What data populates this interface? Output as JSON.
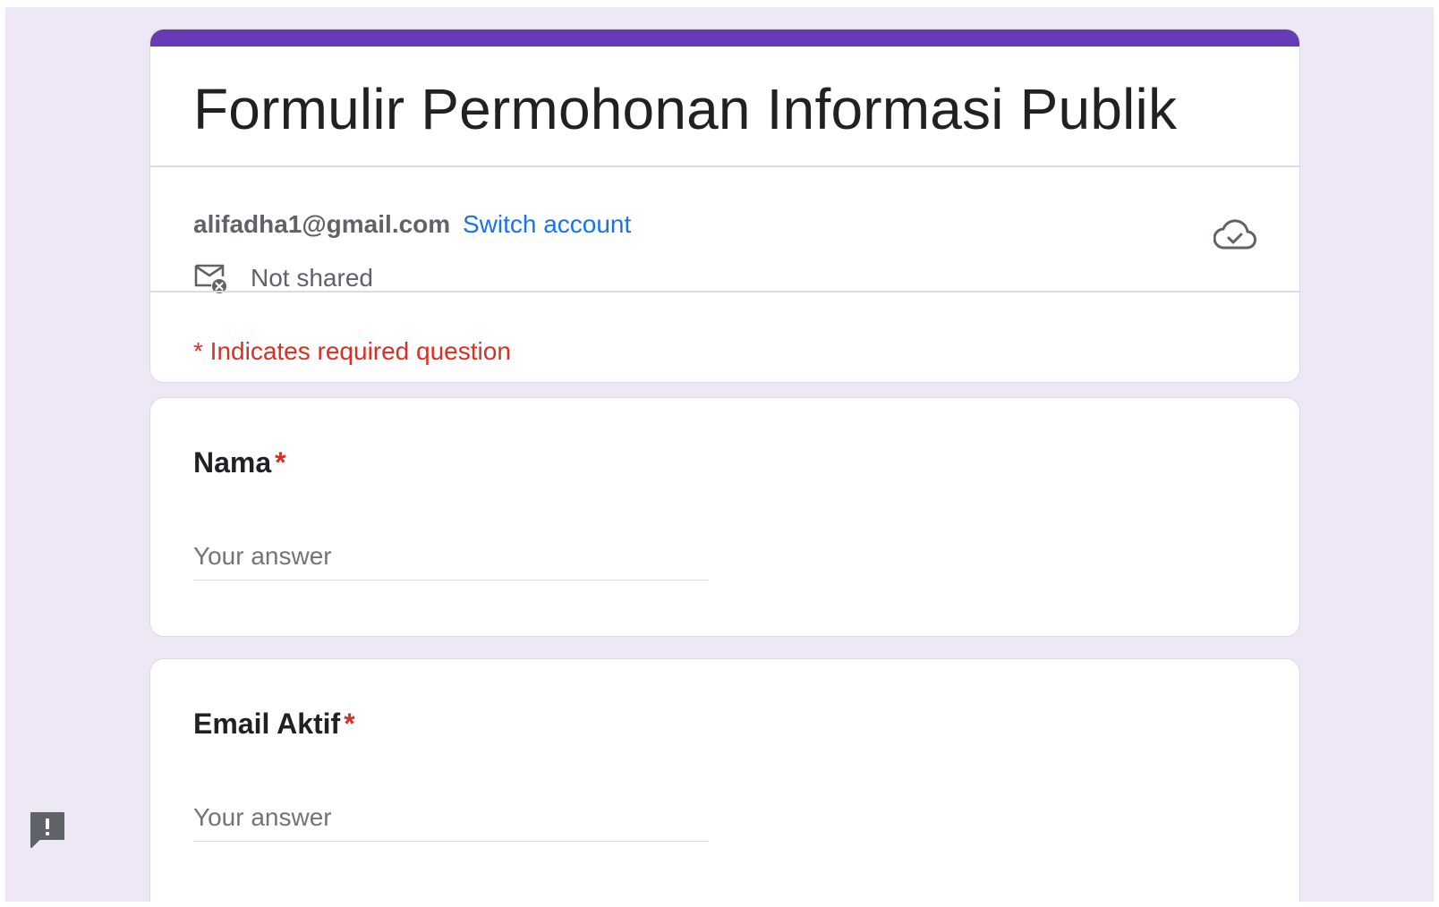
{
  "form": {
    "title": "Formulir Permohonan Informasi Publik",
    "account_email": "alifadha1@gmail.com",
    "switch_account_label": "Switch account",
    "shared_status": "Not shared",
    "required_note": "* Indicates required question"
  },
  "questions": [
    {
      "label": "Nama",
      "required_mark": "*",
      "placeholder": "Your answer",
      "value": ""
    },
    {
      "label": "Email Aktif",
      "required_mark": "*",
      "placeholder": "Your answer",
      "value": ""
    }
  ],
  "icons": {
    "cloud": "cloud-check-icon",
    "mail": "mail-not-shared-icon",
    "feedback": "report-feedback-icon"
  },
  "colors": {
    "accent": "#673ab7",
    "background": "#ede7f6",
    "link": "#1a73e8",
    "required": "#d93025"
  }
}
